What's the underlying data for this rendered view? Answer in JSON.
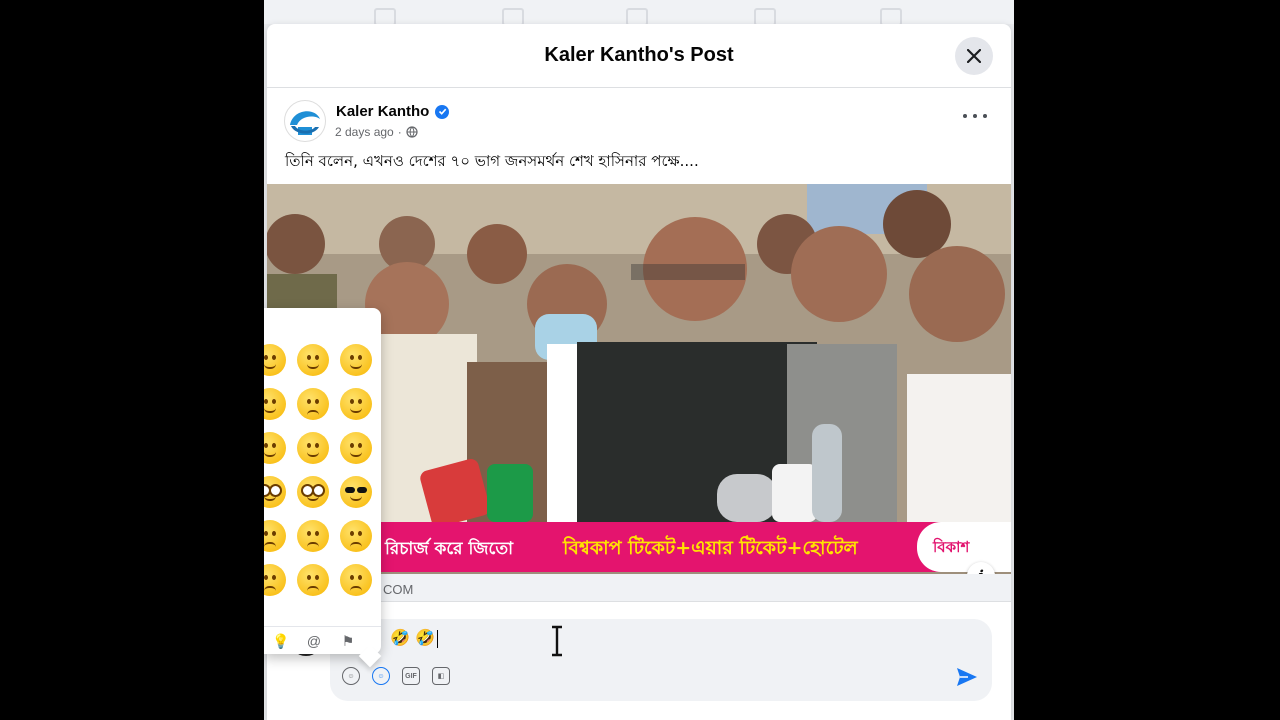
{
  "dialog": {
    "title": "Kaler Kantho's Post",
    "close_icon": "close-icon"
  },
  "post": {
    "page_name": "Kaler Kantho",
    "verified_icon": "verified-badge-icon",
    "time": "2 days ago",
    "separator": "·",
    "audience_icon": "globe-icon",
    "text": "তিনি বলেন, এখনও দেশের ৭০ ভাগ জনসমর্থন শেখ হাসিনার পক্ষে....",
    "link_domain": "COM"
  },
  "banner": {
    "text_left": "রিচার্জ করে জিতো",
    "text_right": "বিশ্বকাপ টিকেট+এয়ার টিকেট+হোটেল",
    "brand": "বিকাশ"
  },
  "info_label": "i",
  "comment": {
    "typed_text": "🤣 🤣",
    "tools": [
      "avatar-sticker-icon",
      "emoji-icon",
      "gif-icon",
      "sticker-icon"
    ],
    "gif_label": "GIF",
    "send_icon": "send-icon"
  },
  "emoji_picker": {
    "tabs": [
      "lightbulb-icon",
      "at-symbol-icon",
      "flag-icon"
    ]
  },
  "colors": {
    "accent": "#1877f2",
    "banner": "#e4146e",
    "banner_highlight": "#ffe400"
  }
}
